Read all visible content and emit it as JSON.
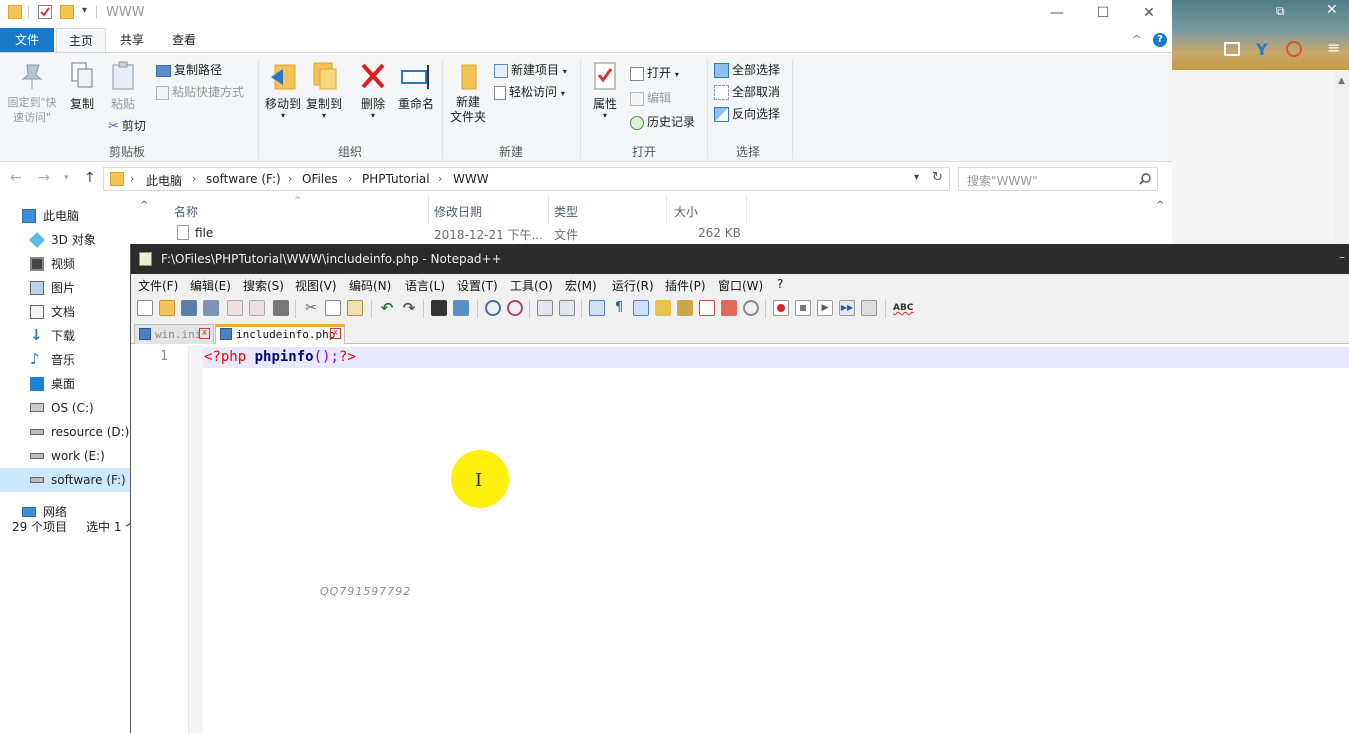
{
  "explorer": {
    "title": "WWW",
    "tabs": [
      "文件",
      "主页",
      "共享",
      "查看"
    ],
    "ribbon": {
      "clipboard": {
        "pin": "固定到\"快\n速访问\"",
        "copy": "复制",
        "paste": "粘贴",
        "copy_path": "复制路径",
        "paste_shortcut": "粘贴快捷方式",
        "cut": "剪切",
        "label": "剪贴板"
      },
      "organize": {
        "move_to": "移动到",
        "copy_to": "复制到",
        "delete": "删除",
        "rename": "重命名",
        "label": "组织"
      },
      "new": {
        "new_folder": "新建\n文件夹",
        "new_item": "新建项目",
        "easy_access": "轻松访问",
        "label": "新建"
      },
      "open": {
        "properties": "属性",
        "open": "打开",
        "edit": "编辑",
        "history": "历史记录",
        "label": "打开"
      },
      "select": {
        "select_all": "全部选择",
        "select_none": "全部取消",
        "invert": "反向选择",
        "label": "选择"
      }
    },
    "breadcrumb": [
      "此电脑",
      "software (F:)",
      "OFiles",
      "PHPTutorial",
      "WWW"
    ],
    "search_placeholder": "搜索\"WWW\"",
    "nav": [
      "此电脑",
      "3D 对象",
      "视频",
      "图片",
      "文档",
      "下载",
      "音乐",
      "桌面",
      "OS (C:)",
      "resource (D:)",
      "work (E:)",
      "software (F:)",
      "网络"
    ],
    "columns": [
      "名称",
      "修改日期",
      "类型",
      "大小"
    ],
    "files": [
      {
        "name": "file",
        "date": "2018-12-21 下午...",
        "type": "文件",
        "size": "262 KB"
      }
    ],
    "status": {
      "count": "29 个项目",
      "selected": "选中 1 个"
    }
  },
  "notepad": {
    "title": "F:\\OFiles\\PHPTutorial\\WWW\\includeinfo.php - Notepad++",
    "menu": [
      "文件(F)",
      "编辑(E)",
      "搜索(S)",
      "视图(V)",
      "编码(N)",
      "语言(L)",
      "设置(T)",
      "工具(O)",
      "宏(M)",
      "运行(R)",
      "插件(P)",
      "窗口(W)",
      "?"
    ],
    "tabs": [
      {
        "label": "win.ini",
        "active": false
      },
      {
        "label": "includeinfo.php",
        "active": true
      }
    ],
    "line_number": "1",
    "code": {
      "open_tag": "<?php",
      "fn": "phpinfo",
      "parens": "();",
      "close_tag": "?>"
    },
    "watermark": "QQ791597792"
  }
}
